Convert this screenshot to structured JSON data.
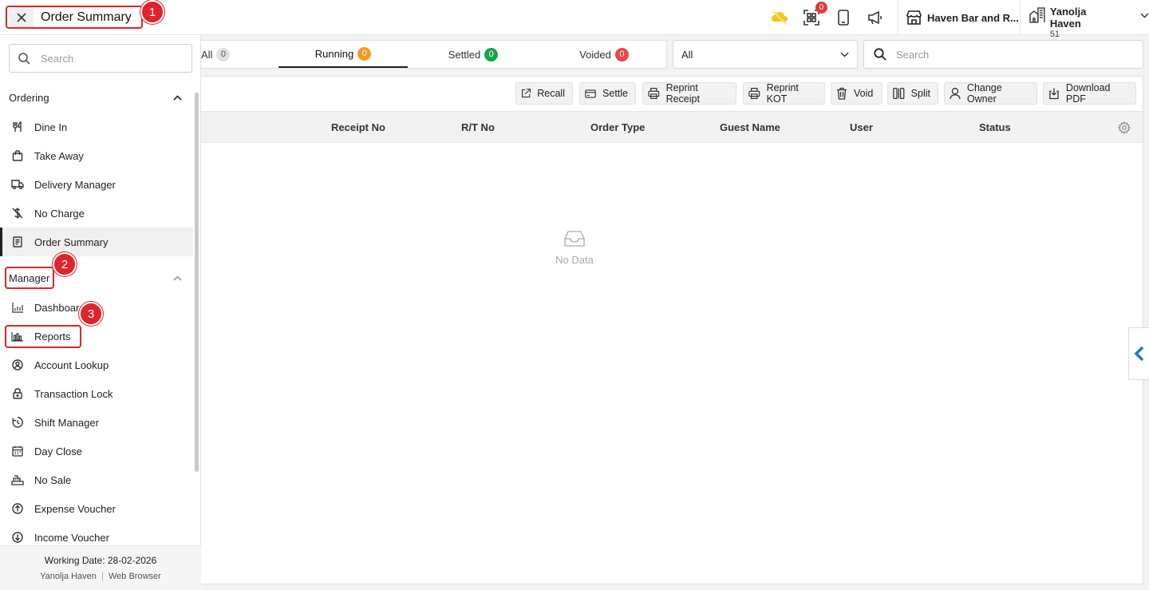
{
  "header": {
    "title": "Order Summary",
    "qr_badge_count": "0",
    "store_name": "Haven Bar and R...",
    "user_name": "Yanolja Haven",
    "user_number": "51"
  },
  "annotations": [
    "1",
    "2",
    "3"
  ],
  "sidebar": {
    "search_placeholder": "Search",
    "ordering_label": "Ordering",
    "ordering_items": [
      {
        "label": "Dine In",
        "icon": "dine-in-icon"
      },
      {
        "label": "Take Away",
        "icon": "take-away-icon"
      },
      {
        "label": "Delivery Manager",
        "icon": "delivery-truck-icon"
      },
      {
        "label": "No Charge",
        "icon": "no-charge-icon"
      },
      {
        "label": "Order Summary",
        "icon": "order-summary-icon",
        "active": true
      }
    ],
    "manager_label": "Manager",
    "manager_items": [
      {
        "label": "Dashboard",
        "icon": "dashboard-icon"
      },
      {
        "label": "Reports",
        "icon": "reports-icon"
      },
      {
        "label": "Account Lookup",
        "icon": "account-lookup-icon"
      },
      {
        "label": "Transaction Lock",
        "icon": "lock-icon"
      },
      {
        "label": "Shift Manager",
        "icon": "shift-manager-icon"
      },
      {
        "label": "Day Close",
        "icon": "calendar-icon"
      },
      {
        "label": "No Sale",
        "icon": "cash-register-icon"
      },
      {
        "label": "Expense Voucher",
        "icon": "expense-up-icon"
      },
      {
        "label": "Income Voucher",
        "icon": "income-down-icon"
      }
    ],
    "footer": {
      "working_date_label": "Working Date:",
      "working_date": "28-02-2026",
      "user": "Yanolja Haven",
      "separator": "|",
      "platform": "Web Browser"
    }
  },
  "tabs": [
    {
      "label": "All",
      "count": "0",
      "color": "#e0e0e0"
    },
    {
      "label": "Running",
      "count": "0",
      "color": "#f59a23",
      "active": true
    },
    {
      "label": "Settled",
      "count": "0",
      "color": "#17a34a"
    },
    {
      "label": "Voided",
      "count": "0",
      "color": "#ef4444"
    }
  ],
  "filter": {
    "selected": "All"
  },
  "main_search": {
    "placeholder": "Search"
  },
  "toolbar": [
    "Recall",
    "Settle",
    "Reprint Receipt",
    "Reprint KOT",
    "Void",
    "Split",
    "Change Owner",
    "Download PDF"
  ],
  "table": {
    "columns": [
      "Receipt No",
      "R/T No",
      "Order Type",
      "Guest Name",
      "User",
      "Status"
    ],
    "empty_text": "No Data"
  }
}
